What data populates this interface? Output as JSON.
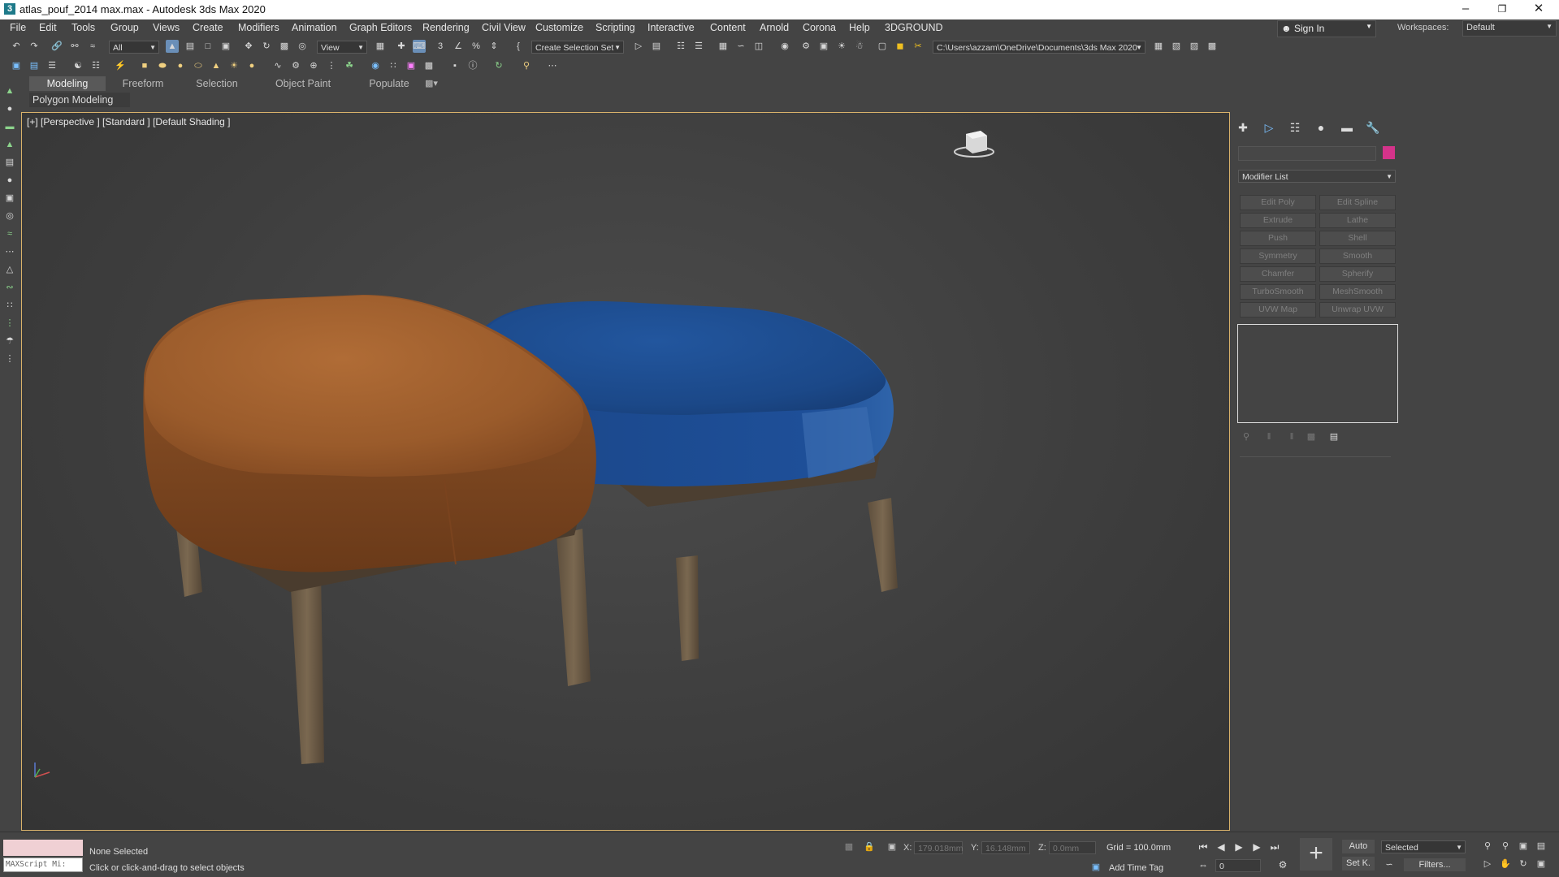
{
  "window": {
    "title": "atlas_pouf_2014 max.max - Autodesk 3ds Max 2020",
    "app_icon": "3",
    "minimize": "–",
    "restore": "❐",
    "close": "✕"
  },
  "menubar": {
    "items": [
      "File",
      "Edit",
      "Tools",
      "Group",
      "Views",
      "Create",
      "Modifiers",
      "Animation",
      "Graph Editors",
      "Rendering",
      "Civil View",
      "Customize",
      "Scripting",
      "Interactive",
      "Content",
      "Arnold",
      "Corona",
      "Help",
      "3DGROUND"
    ],
    "sign_in": "Sign In",
    "workspaces_label": "Workspaces:",
    "workspace_value": "Default"
  },
  "toolbar": {
    "selection_filter": "All",
    "ref_coord": "View",
    "named_selection": "Create Selection Set",
    "project_path": "C:\\Users\\azzam\\OneDrive\\Documents\\3ds Max 2020"
  },
  "ribbon": {
    "tabs": [
      "Modeling",
      "Freeform",
      "Selection",
      "Object Paint",
      "Populate"
    ],
    "active_tab": "Modeling",
    "panel_label": "Polygon Modeling"
  },
  "viewport": {
    "label": "[+] [Perspective ] [Standard ] [Default Shading ]"
  },
  "command_panel": {
    "tabs": [
      "create-tab",
      "modify-tab",
      "hierarchy-tab",
      "motion-tab",
      "display-tab",
      "utilities-tab"
    ],
    "object_name": "",
    "object_color": "#d4338a",
    "modifier_list": "Modifier List",
    "modifier_buttons": [
      "Edit Poly",
      "Edit Spline",
      "Extrude",
      "Lathe",
      "Push",
      "Shell",
      "Symmetry",
      "Smooth",
      "Chamfer",
      "Spherify",
      "TurboSmooth",
      "MeshSmooth",
      "UVW Map",
      "Unwrap UVW"
    ]
  },
  "statusbar": {
    "maxscript": "MAXScript Mi:",
    "selection_status": "None Selected",
    "prompt": "Click or click-and-drag to select objects",
    "x_label": "X:",
    "x_value": "179.018mm",
    "y_label": "Y:",
    "y_value": "16.148mm",
    "z_label": "Z:",
    "z_value": "0.0mm",
    "grid": "Grid = 100.0mm",
    "add_time_tag": "Add Time Tag",
    "auto": "Auto",
    "set_key": "Set K.",
    "selected": "Selected",
    "filters": "Filters...",
    "frame": "0"
  },
  "colors": {
    "accent_viewport_border": "#d9b26a",
    "leather": "#a0622f",
    "fabric": "#1f4d93",
    "wood": "#6b5a45"
  }
}
